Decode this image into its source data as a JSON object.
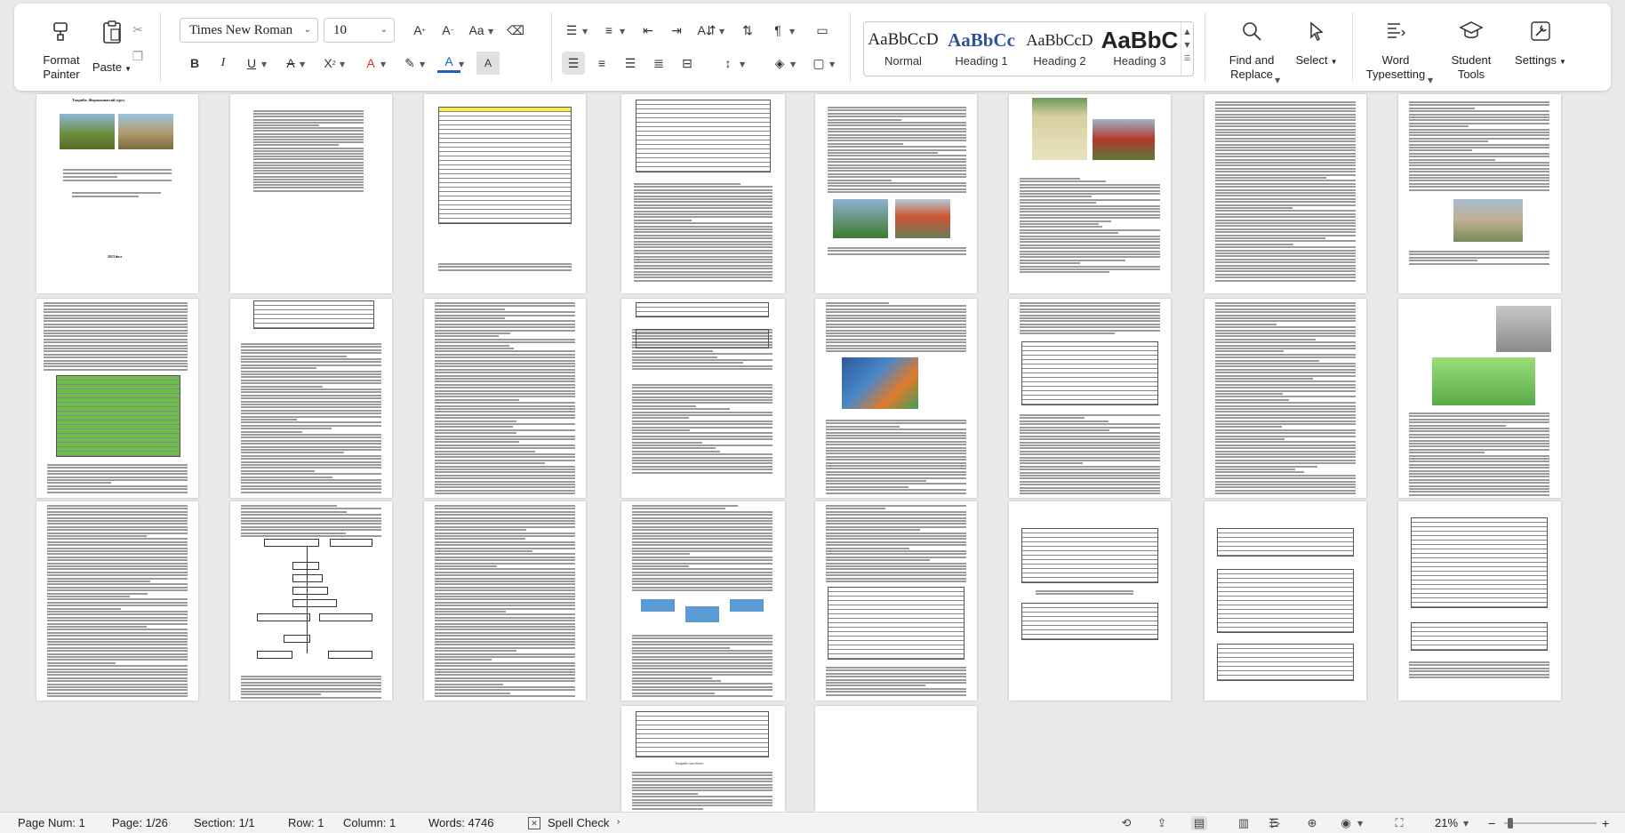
{
  "ribbon": {
    "format_painter": "Format\nPainter",
    "paste": "Paste",
    "font_name": "Times New Roman",
    "font_size": "10",
    "styles": [
      {
        "sample": "AaBbCcD",
        "name": "Normal"
      },
      {
        "sample": "AaBbCc",
        "name": "Heading 1"
      },
      {
        "sample": "AaBbCcD",
        "name": "Heading 2"
      },
      {
        "sample": "AaBbC",
        "name": "Heading 3"
      }
    ],
    "find_replace": "Find and\nReplace",
    "select": "Select",
    "word_typesetting": "Word\nTypesetting",
    "student_tools": "Student\nTools",
    "settings": "Settings"
  },
  "status": {
    "page_num": "Page Num: 1",
    "page": "Page: 1/26",
    "section": "Section: 1/1",
    "row": "Row: 1",
    "column": "Column: 1",
    "words": "Words: 4746",
    "spell_check": "Spell Check",
    "zoom": "21%"
  },
  "colors": {
    "accent_blue": "#1f5fbf",
    "font_color_red": "#d93025",
    "highlight_yellow": "#f2d31b",
    "green_table": "#6cc04a",
    "yellow_table": "#f4ef4a"
  },
  "pages_text": {
    "p1_title": "Тажриба: Жиракомпатсий гуруҳ",
    "p1_year": "2023 йил",
    "p25_label": "Тажриба хисоботи"
  }
}
